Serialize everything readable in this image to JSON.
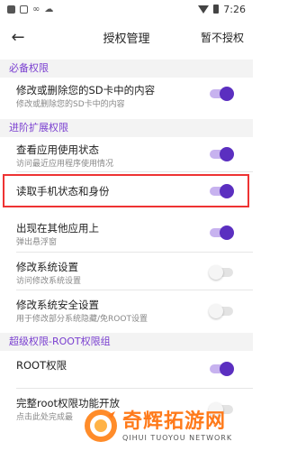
{
  "status_bar": {
    "time": "7:26"
  },
  "toolbar": {
    "back_icon": "arrow-left-icon",
    "title": "授权管理",
    "action": "暂不授权"
  },
  "sections": [
    {
      "label": "必备权限"
    },
    {
      "label": "进阶扩展权限"
    },
    {
      "label": "超级权限-ROOT权限组"
    }
  ],
  "permissions": [
    {
      "title": "修改或删除您的SD卡中的内容",
      "subtitle": "修改或删除您的SD卡中的内容",
      "enabled": true
    },
    {
      "title": "查看应用使用状态",
      "subtitle": "访问最近应用程序使用情况",
      "enabled": true
    },
    {
      "title": "读取手机状态和身份",
      "subtitle": "",
      "enabled": true
    },
    {
      "title": "出现在其他应用上",
      "subtitle": "弹出悬浮窗",
      "enabled": true
    },
    {
      "title": "修改系统设置",
      "subtitle": "访问修改系统设置",
      "enabled": false
    },
    {
      "title": "修改系统安全设置",
      "subtitle": "用于修改部分系统隐藏/免ROOT设置",
      "enabled": false
    },
    {
      "title": "ROOT权限",
      "subtitle": "",
      "enabled": true
    },
    {
      "title": "完整root权限功能开放",
      "subtitle": "点击此处完成最",
      "enabled": false
    }
  ],
  "watermark": {
    "name": "奇辉拓游网",
    "subtitle": "QIHUI TUOYOU NETWORK"
  },
  "colors": {
    "accent": "#5b2fc0",
    "section_text": "#7a3fd0",
    "highlight": "#ee3333",
    "watermark": "#ff7a1a"
  }
}
